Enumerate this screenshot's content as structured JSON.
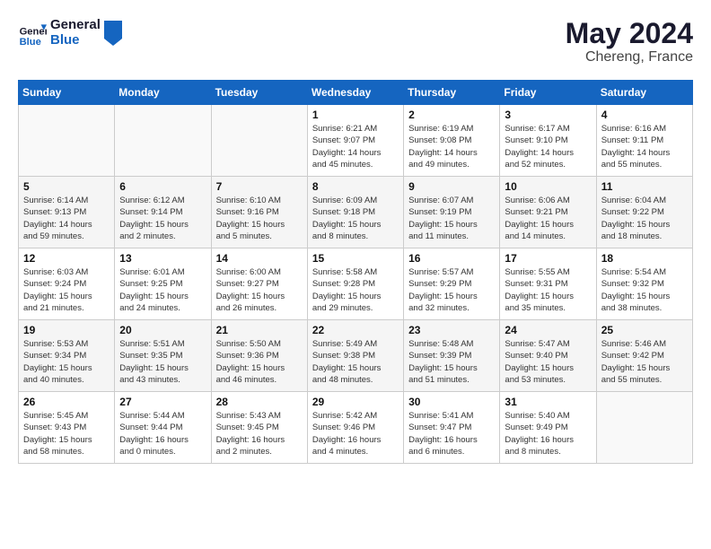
{
  "header": {
    "logo_line1": "General",
    "logo_line2": "Blue",
    "month_year": "May 2024",
    "location": "Chereng, France"
  },
  "weekdays": [
    "Sunday",
    "Monday",
    "Tuesday",
    "Wednesday",
    "Thursday",
    "Friday",
    "Saturday"
  ],
  "weeks": [
    [
      {
        "day": "",
        "info": ""
      },
      {
        "day": "",
        "info": ""
      },
      {
        "day": "",
        "info": ""
      },
      {
        "day": "1",
        "info": "Sunrise: 6:21 AM\nSunset: 9:07 PM\nDaylight: 14 hours\nand 45 minutes."
      },
      {
        "day": "2",
        "info": "Sunrise: 6:19 AM\nSunset: 9:08 PM\nDaylight: 14 hours\nand 49 minutes."
      },
      {
        "day": "3",
        "info": "Sunrise: 6:17 AM\nSunset: 9:10 PM\nDaylight: 14 hours\nand 52 minutes."
      },
      {
        "day": "4",
        "info": "Sunrise: 6:16 AM\nSunset: 9:11 PM\nDaylight: 14 hours\nand 55 minutes."
      }
    ],
    [
      {
        "day": "5",
        "info": "Sunrise: 6:14 AM\nSunset: 9:13 PM\nDaylight: 14 hours\nand 59 minutes."
      },
      {
        "day": "6",
        "info": "Sunrise: 6:12 AM\nSunset: 9:14 PM\nDaylight: 15 hours\nand 2 minutes."
      },
      {
        "day": "7",
        "info": "Sunrise: 6:10 AM\nSunset: 9:16 PM\nDaylight: 15 hours\nand 5 minutes."
      },
      {
        "day": "8",
        "info": "Sunrise: 6:09 AM\nSunset: 9:18 PM\nDaylight: 15 hours\nand 8 minutes."
      },
      {
        "day": "9",
        "info": "Sunrise: 6:07 AM\nSunset: 9:19 PM\nDaylight: 15 hours\nand 11 minutes."
      },
      {
        "day": "10",
        "info": "Sunrise: 6:06 AM\nSunset: 9:21 PM\nDaylight: 15 hours\nand 14 minutes."
      },
      {
        "day": "11",
        "info": "Sunrise: 6:04 AM\nSunset: 9:22 PM\nDaylight: 15 hours\nand 18 minutes."
      }
    ],
    [
      {
        "day": "12",
        "info": "Sunrise: 6:03 AM\nSunset: 9:24 PM\nDaylight: 15 hours\nand 21 minutes."
      },
      {
        "day": "13",
        "info": "Sunrise: 6:01 AM\nSunset: 9:25 PM\nDaylight: 15 hours\nand 24 minutes."
      },
      {
        "day": "14",
        "info": "Sunrise: 6:00 AM\nSunset: 9:27 PM\nDaylight: 15 hours\nand 26 minutes."
      },
      {
        "day": "15",
        "info": "Sunrise: 5:58 AM\nSunset: 9:28 PM\nDaylight: 15 hours\nand 29 minutes."
      },
      {
        "day": "16",
        "info": "Sunrise: 5:57 AM\nSunset: 9:29 PM\nDaylight: 15 hours\nand 32 minutes."
      },
      {
        "day": "17",
        "info": "Sunrise: 5:55 AM\nSunset: 9:31 PM\nDaylight: 15 hours\nand 35 minutes."
      },
      {
        "day": "18",
        "info": "Sunrise: 5:54 AM\nSunset: 9:32 PM\nDaylight: 15 hours\nand 38 minutes."
      }
    ],
    [
      {
        "day": "19",
        "info": "Sunrise: 5:53 AM\nSunset: 9:34 PM\nDaylight: 15 hours\nand 40 minutes."
      },
      {
        "day": "20",
        "info": "Sunrise: 5:51 AM\nSunset: 9:35 PM\nDaylight: 15 hours\nand 43 minutes."
      },
      {
        "day": "21",
        "info": "Sunrise: 5:50 AM\nSunset: 9:36 PM\nDaylight: 15 hours\nand 46 minutes."
      },
      {
        "day": "22",
        "info": "Sunrise: 5:49 AM\nSunset: 9:38 PM\nDaylight: 15 hours\nand 48 minutes."
      },
      {
        "day": "23",
        "info": "Sunrise: 5:48 AM\nSunset: 9:39 PM\nDaylight: 15 hours\nand 51 minutes."
      },
      {
        "day": "24",
        "info": "Sunrise: 5:47 AM\nSunset: 9:40 PM\nDaylight: 15 hours\nand 53 minutes."
      },
      {
        "day": "25",
        "info": "Sunrise: 5:46 AM\nSunset: 9:42 PM\nDaylight: 15 hours\nand 55 minutes."
      }
    ],
    [
      {
        "day": "26",
        "info": "Sunrise: 5:45 AM\nSunset: 9:43 PM\nDaylight: 15 hours\nand 58 minutes."
      },
      {
        "day": "27",
        "info": "Sunrise: 5:44 AM\nSunset: 9:44 PM\nDaylight: 16 hours\nand 0 minutes."
      },
      {
        "day": "28",
        "info": "Sunrise: 5:43 AM\nSunset: 9:45 PM\nDaylight: 16 hours\nand 2 minutes."
      },
      {
        "day": "29",
        "info": "Sunrise: 5:42 AM\nSunset: 9:46 PM\nDaylight: 16 hours\nand 4 minutes."
      },
      {
        "day": "30",
        "info": "Sunrise: 5:41 AM\nSunset: 9:47 PM\nDaylight: 16 hours\nand 6 minutes."
      },
      {
        "day": "31",
        "info": "Sunrise: 5:40 AM\nSunset: 9:49 PM\nDaylight: 16 hours\nand 8 minutes."
      },
      {
        "day": "",
        "info": ""
      }
    ]
  ]
}
